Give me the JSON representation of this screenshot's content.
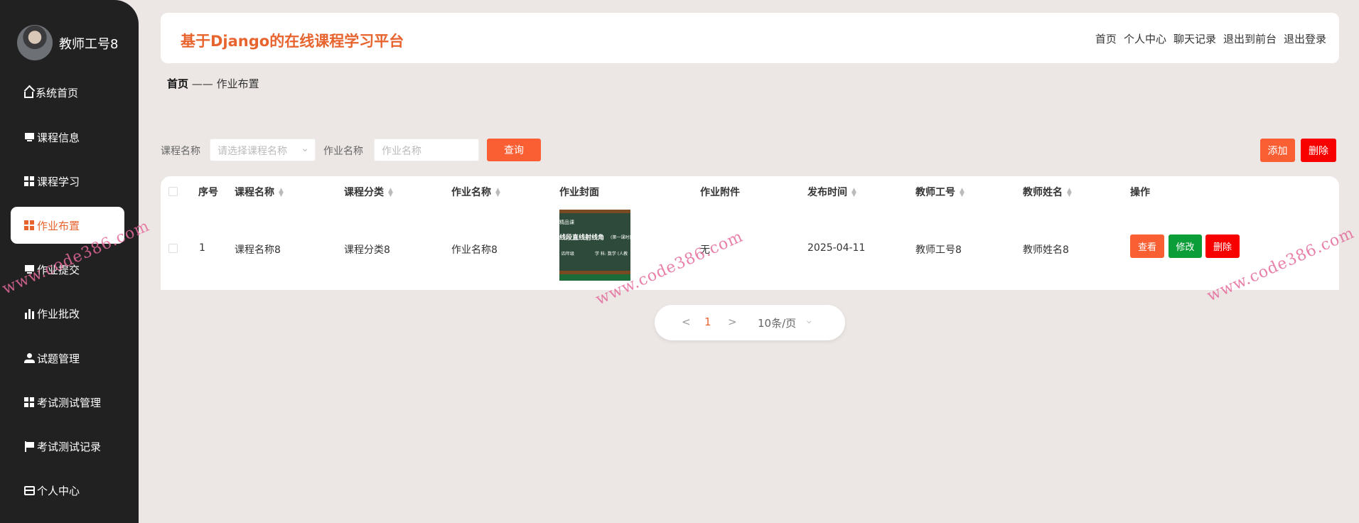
{
  "user": {
    "name": "教师工号8"
  },
  "sidebar": {
    "items": [
      {
        "label": "系统首页",
        "icon": "home-icon"
      },
      {
        "label": "课程信息",
        "icon": "monitor-icon"
      },
      {
        "label": "课程学习",
        "icon": "grid-icon"
      },
      {
        "label": "作业布置",
        "icon": "grid-icon",
        "active": true
      },
      {
        "label": "作业提交",
        "icon": "monitor-icon"
      },
      {
        "label": "作业批改",
        "icon": "bar-chart-icon"
      },
      {
        "label": "试题管理",
        "icon": "user-icon"
      },
      {
        "label": "考试测试管理",
        "icon": "grid-icon"
      },
      {
        "label": "考试测试记录",
        "icon": "flag-icon"
      },
      {
        "label": "个人中心",
        "icon": "card-icon"
      }
    ]
  },
  "header": {
    "title": "基于Django的在线课程学习平台",
    "nav": [
      "首页",
      "个人中心",
      "聊天记录",
      "退出到前台",
      "退出登录"
    ]
  },
  "breadcrumb": {
    "home": "首页",
    "sep": "——",
    "current": "作业布置"
  },
  "search": {
    "course_label": "课程名称",
    "course_placeholder": "请选择课程名称",
    "hw_label": "作业名称",
    "hw_placeholder": "作业名称",
    "query": "查询",
    "add": "添加",
    "delete": "删除"
  },
  "table": {
    "headers": [
      "序号",
      "课程名称",
      "课程分类",
      "作业名称",
      "作业封面",
      "作业附件",
      "发布时间",
      "教师工号",
      "教师姓名",
      "操作"
    ],
    "rows": [
      {
        "index": "1",
        "course": "课程名称8",
        "category": "课程分类8",
        "hw": "作业名称8",
        "cover_title": "线段直线射线角",
        "cover_sub": "(第一课时)",
        "cover_top": "精品课",
        "cover_grade": "四年级",
        "cover_subject": "学 科: 数学 (人教",
        "attachment": "无",
        "date": "2025-04-11",
        "teacher_no": "教师工号8",
        "teacher_name": "教师姓名8"
      }
    ],
    "actions": {
      "view": "查看",
      "edit": "修改",
      "delete": "删除"
    }
  },
  "pagination": {
    "prev": "<",
    "page": "1",
    "next": ">",
    "size": "10条/页"
  },
  "watermark": "www.code386.com",
  "colors": {
    "accent": "#e8642f",
    "orange": "#fa5f34",
    "red": "#f80000",
    "green": "#0b9e38",
    "sidebar": "#222122"
  }
}
